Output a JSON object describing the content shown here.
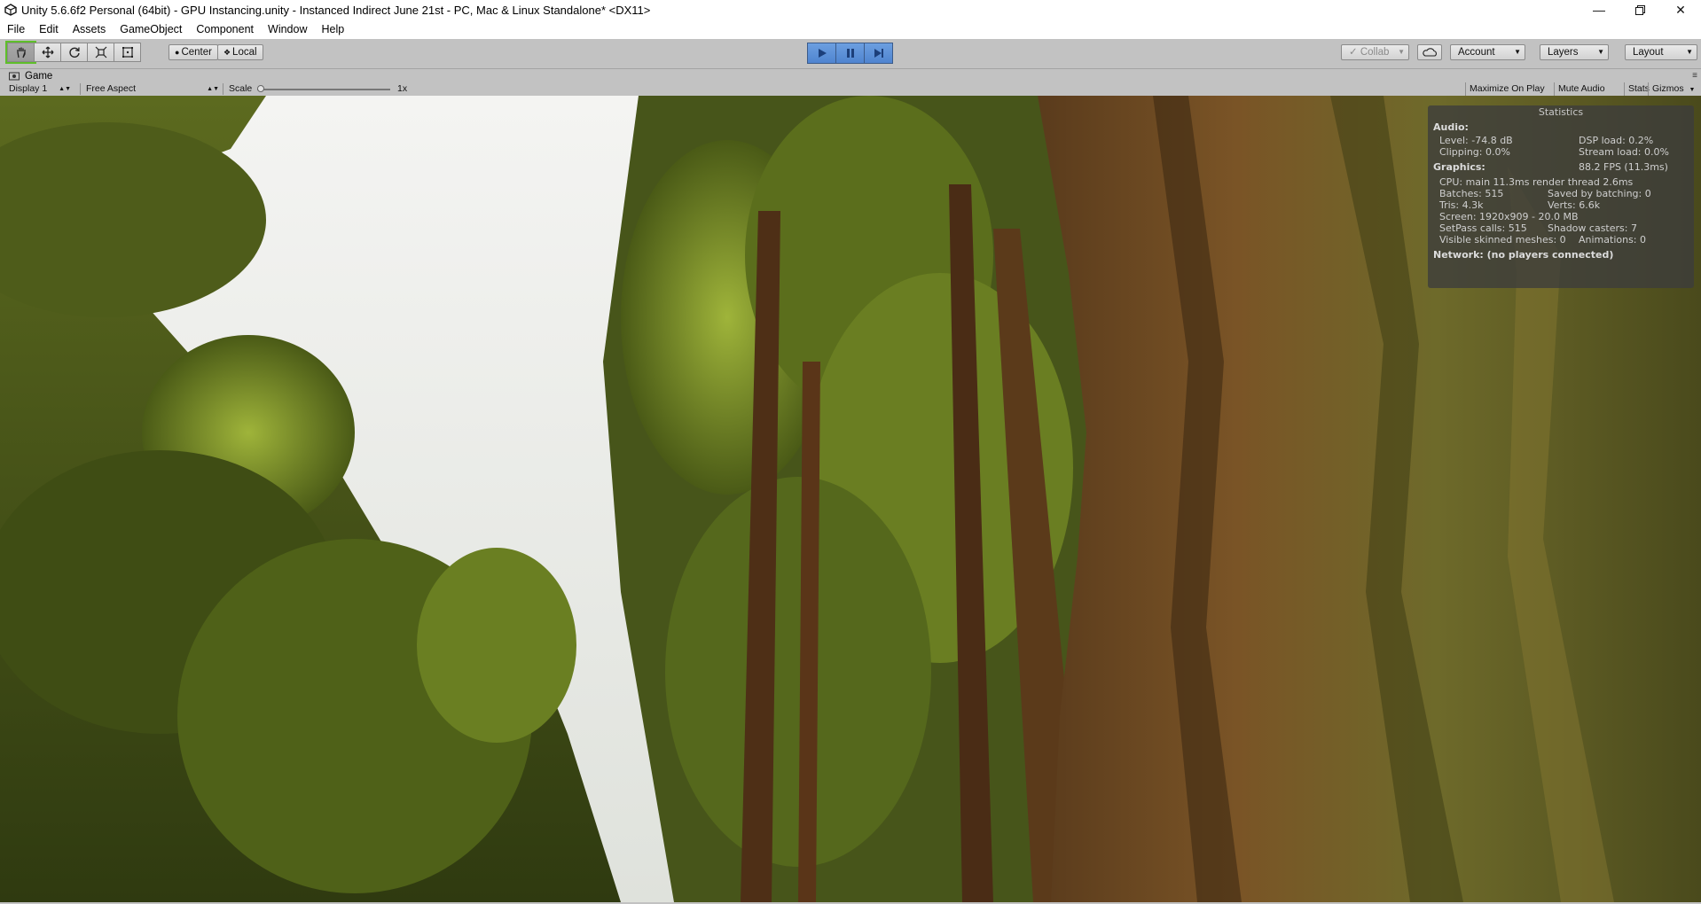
{
  "window": {
    "title": "Unity 5.6.6f2 Personal (64bit) - GPU Instancing.unity - Instanced Indirect June 21st - PC, Mac & Linux Standalone* <DX11>",
    "controls": [
      "minimize-icon",
      "restore-icon",
      "close-icon"
    ]
  },
  "menu": [
    "File",
    "Edit",
    "Assets",
    "GameObject",
    "Component",
    "Window",
    "Help"
  ],
  "toolbar": {
    "transform_tools": [
      "hand-icon",
      "move-icon",
      "rotate-icon",
      "scale-icon",
      "rect-icon"
    ],
    "pivot_label": "Center",
    "space_label": "Local",
    "play_controls": [
      "play-icon",
      "pause-icon",
      "step-icon"
    ],
    "collab_label": "Collab",
    "account_label": "Account",
    "layers_label": "Layers",
    "layout_label": "Layout",
    "accent_color": "#5a8fd8"
  },
  "game_view": {
    "tab_label": "Game",
    "display": "Display 1",
    "aspect": "Free Aspect",
    "scale_label": "Scale",
    "scale_value": "1x",
    "maximize_label": "Maximize On Play",
    "mute_label": "Mute Audio",
    "stats_label": "Stats",
    "gizmos_label": "Gizmos"
  },
  "stats": {
    "title": "Statistics",
    "audio_header": "Audio:",
    "level": "Level: -74.8 dB",
    "dsp_load": "DSP load: 0.2%",
    "clipping": "Clipping: 0.0%",
    "stream_load": "Stream load: 0.0%",
    "graphics_header": "Graphics:",
    "fps": "88.2 FPS (11.3ms)",
    "cpu": "CPU: main 11.3ms  render thread 2.6ms",
    "batches": "Batches: 515",
    "saved_batching": "Saved by batching: 0",
    "tris": "Tris: 4.3k",
    "verts": "Verts: 6.6k",
    "screen": "Screen: 1920x909 - 20.0 MB",
    "setpass": "SetPass calls: 515",
    "shadow_casters": "Shadow casters: 7",
    "skinned": "Visible skinned meshes: 0",
    "animations": "Animations: 0",
    "network": "Network: (no players connected)"
  }
}
